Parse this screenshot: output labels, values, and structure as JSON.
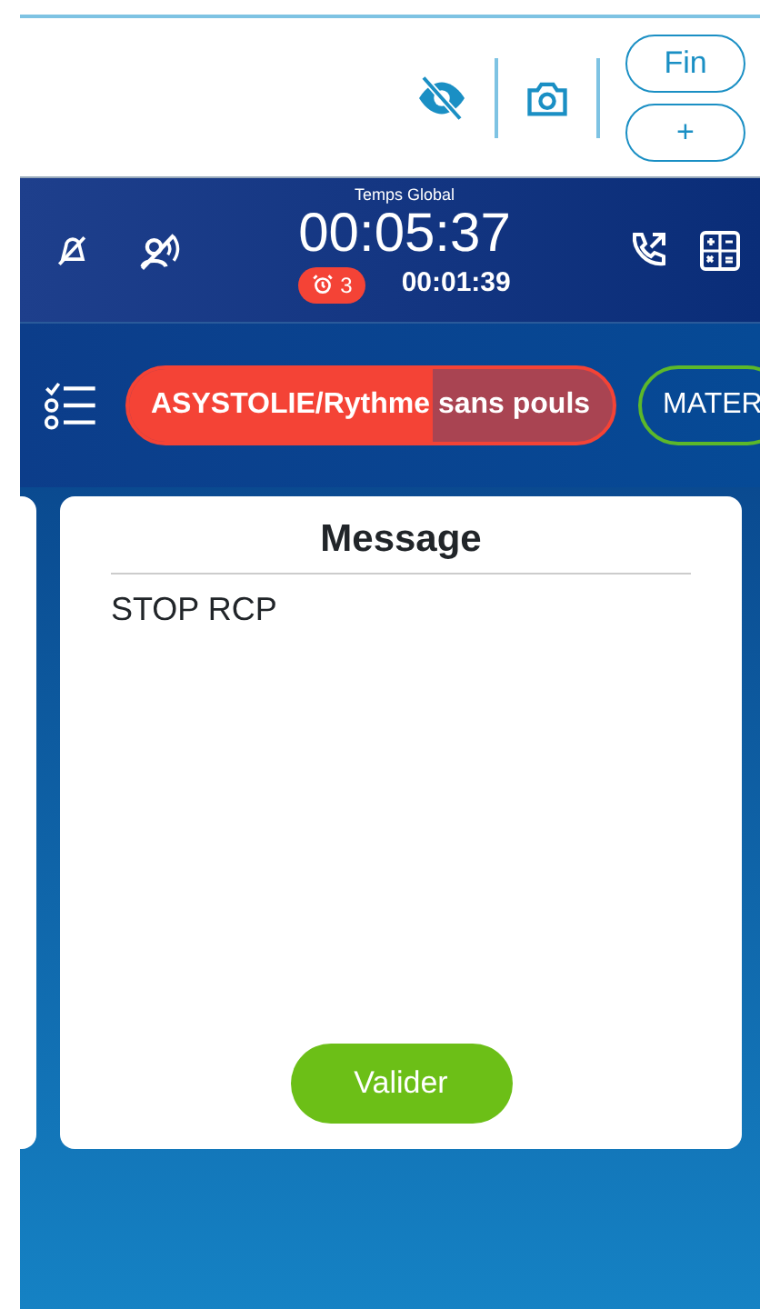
{
  "toolbar": {
    "buttons": [
      {
        "label": "Fin"
      },
      {
        "label": "+"
      }
    ]
  },
  "header": {
    "title": "Temps Global",
    "global_time": "00:05:37",
    "alarm_count": "3",
    "cycle_time": "00:01:39"
  },
  "protocols": [
    {
      "label": "ASYSTOLIE/Rythme sans pouls",
      "selected": true,
      "level": 0.63,
      "color": "#f44336"
    },
    {
      "label": "MATER",
      "selected": false,
      "color": "#5cb82a"
    }
  ],
  "dialog": {
    "title": "Message",
    "text": "STOP RCP",
    "button": "Valider"
  }
}
